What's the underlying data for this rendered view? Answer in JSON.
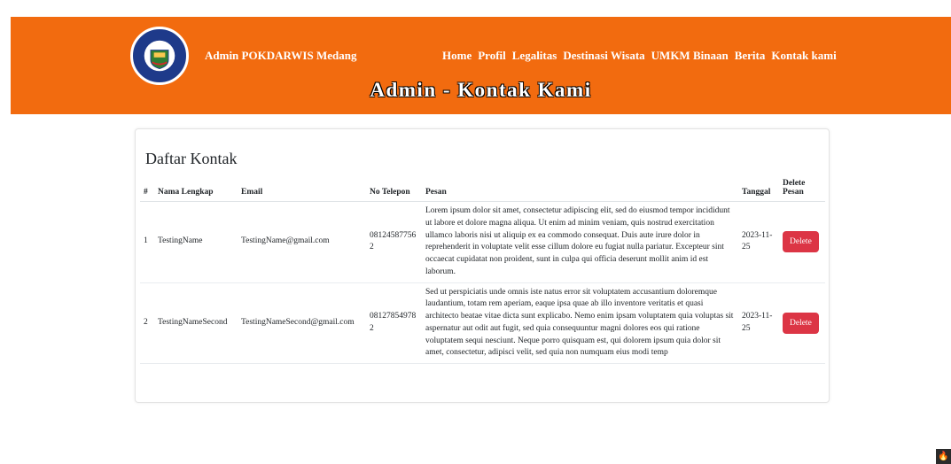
{
  "brand": {
    "name": "Admin POKDARWIS Medang",
    "logo_top_text": "POKDARWIS",
    "logo_bottom_text": "KEL. MEDANG"
  },
  "nav": {
    "items": [
      {
        "label": "Home"
      },
      {
        "label": "Profil"
      },
      {
        "label": "Legalitas"
      },
      {
        "label": "Destinasi Wisata"
      },
      {
        "label": "UMKM Binaan"
      },
      {
        "label": "Berita"
      },
      {
        "label": "Kontak kami"
      }
    ]
  },
  "page_title": "Admin - Kontak Kami",
  "card": {
    "title": "Daftar Kontak",
    "columns": {
      "num": "#",
      "name": "Nama Lengkap",
      "email": "Email",
      "phone": "No Telepon",
      "message": "Pesan",
      "date": "Tanggal",
      "delete": "Delete Pesan"
    },
    "rows": [
      {
        "num": "1",
        "name": "TestingName",
        "email": "TestingName@gmail.com",
        "phone": "081245877562",
        "message": "Lorem ipsum dolor sit amet, consectetur adipiscing elit, sed do eiusmod tempor incididunt ut labore et dolore magna aliqua. Ut enim ad minim veniam, quis nostrud exercitation ullamco laboris nisi ut aliquip ex ea commodo consequat. Duis aute irure dolor in reprehenderit in voluptate velit esse cillum dolore eu fugiat nulla pariatur. Excepteur sint occaecat cupidatat non proident, sunt in culpa qui officia deserunt mollit anim id est laborum.",
        "date": "2023-11-25",
        "delete_label": "Delete"
      },
      {
        "num": "2",
        "name": "TestingNameSecond",
        "email": "TestingNameSecond@gmail.com",
        "phone": "081278549782",
        "message": "Sed ut perspiciatis unde omnis iste natus error sit voluptatem accusantium doloremque laudantium, totam rem aperiam, eaque ipsa quae ab illo inventore veritatis et quasi architecto beatae vitae dicta sunt explicabo. Nemo enim ipsam voluptatem quia voluptas sit aspernatur aut odit aut fugit, sed quia consequuntur magni dolores eos qui ratione voluptatem sequi nesciunt. Neque porro quisquam est, qui dolorem ipsum quia dolor sit amet, consectetur, adipisci velit, sed quia non numquam eius modi temp",
        "date": "2023-11-25",
        "delete_label": "Delete"
      }
    ]
  },
  "colors": {
    "header_bg": "#f26b0f",
    "delete_btn": "#dc3545"
  },
  "corner_icon": "flame-icon"
}
